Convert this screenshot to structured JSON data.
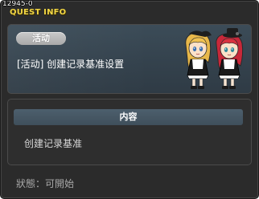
{
  "window": {
    "quest_id": "12945-0",
    "title": "QUEST INFO"
  },
  "quest": {
    "category_label": "活动",
    "name": "[活动] 创建记录基准设置",
    "npc_art": "two-maid-npc-characters"
  },
  "content": {
    "header": "内容",
    "text": "创建记录基准"
  },
  "status": {
    "label": "狀態：",
    "value": "可開始"
  }
}
